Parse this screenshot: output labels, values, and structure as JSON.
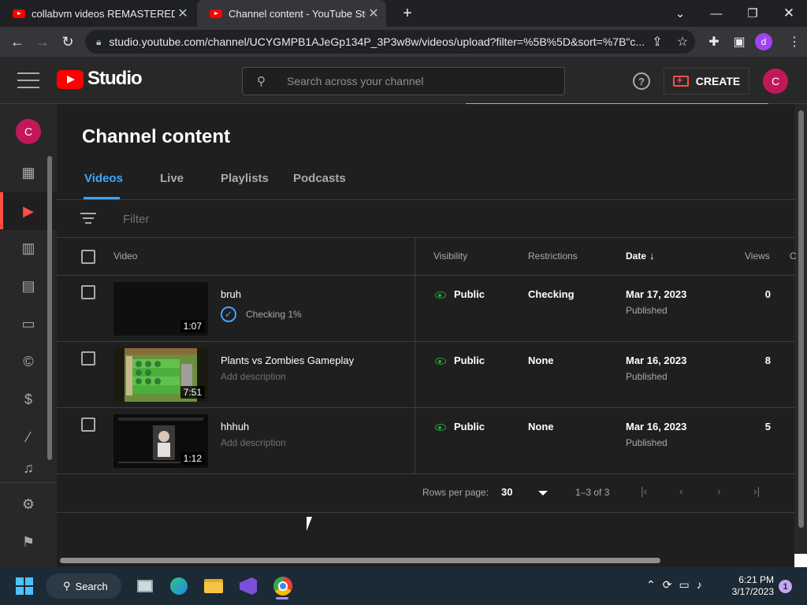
{
  "browser": {
    "tabs": [
      {
        "title": "collabvm videos REMASTERED - Y",
        "close": "✕"
      },
      {
        "title": "Channel content - YouTube Studio",
        "close": "✕"
      }
    ],
    "new_tab": "+",
    "url": "studio.youtube.com/channel/UCYGMPB1AJeGp134P_3P3w8w/videos/upload?filter=%5B%5D&sort=%7B\"c...",
    "profile_initial": "d"
  },
  "header": {
    "logo_text": "Studio",
    "search_placeholder": "Search across your channel",
    "help": "?",
    "create_label": "CREATE",
    "avatar_initial": "C"
  },
  "sidebar": {
    "avatar_initial": "C"
  },
  "page": {
    "title": "Channel content",
    "tabs": [
      "Videos",
      "Live",
      "Playlists",
      "Podcasts"
    ],
    "active_tab": "Videos",
    "filter_placeholder": "Filter"
  },
  "table": {
    "columns": {
      "video": "Video",
      "visibility": "Visibility",
      "restrictions": "Restrictions",
      "date": "Date",
      "views": "Views",
      "comments": "C"
    },
    "sort_indicator": "↓",
    "rows": [
      {
        "title": "bruh",
        "duration": "1:07",
        "subtext": "Checking 1%",
        "visibility": "Public",
        "restrictions": "Checking",
        "date": "Mar 17, 2023",
        "status": "Published",
        "views": "0",
        "checking": true
      },
      {
        "title": "Plants vs Zombies Gameplay",
        "duration": "7:51",
        "subtext": "Add description",
        "visibility": "Public",
        "restrictions": "None",
        "date": "Mar 16, 2023",
        "status": "Published",
        "views": "8",
        "checking": false
      },
      {
        "title": "hhhuh",
        "duration": "1:12",
        "subtext": "Add description",
        "visibility": "Public",
        "restrictions": "None",
        "date": "Mar 16, 2023",
        "status": "Published",
        "views": "5",
        "checking": false
      }
    ]
  },
  "pagination": {
    "rows_per_page_label": "Rows per page:",
    "rows_per_page": "30",
    "range": "1–3 of 3"
  },
  "taskbar": {
    "search_label": "Search",
    "time": "6:21 PM",
    "date": "3/17/2023",
    "notification_count": "1"
  },
  "colors": {
    "accent": "#3ea6ff",
    "brand_red": "#ff0000",
    "public_green": "#2ba640",
    "avatar": "#c2185b"
  }
}
